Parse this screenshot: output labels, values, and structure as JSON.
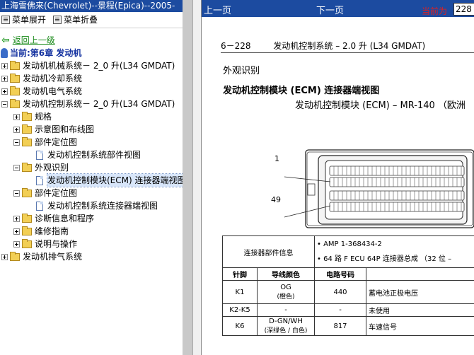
{
  "window": {
    "title": "上海雪佛来(Chevrolet)--景程(Epica)--2005-"
  },
  "toolbar": {
    "expand_label": "菜单展开",
    "collapse_label": "菜单折叠"
  },
  "tree": {
    "back_label": "返回上一级",
    "current_label": "当前:第6章  发动机",
    "items": [
      "发动机机械系统－  2_0 升(L34 GMDAT)",
      "发动机冷却系统",
      "发动机电气系统",
      "发动机控制系统－  2_0 升(L34 GMDAT)",
      "规格",
      "示意图和布线图",
      "部件定位图",
      "发动机控制系统部件视图",
      "外观识别",
      "发动机控制模块(ECM) 连接器端视图",
      "部件定位图",
      "发动机控制系统连接器端视图",
      "诊断信息和程序",
      "维修指南",
      "说明与操作",
      "发动机排气系统"
    ]
  },
  "viewer": {
    "prev_label": "上一页",
    "next_label": "下一页",
    "current_page_label": "当前为",
    "current_page_value": "228"
  },
  "document": {
    "page_number": "6－228",
    "header_title": "发动机控制系统 – 2.0 升 (L34 GMDAT)",
    "section_title": "外观识别",
    "subsection_title": "发动机控制模块 (ECM) 连接器端视图",
    "connector_title": "发动机控制模块 (ECM) – MR-140 （欧洲",
    "pin_label_1": "1",
    "pin_label_49": "49",
    "info_label": "连接器部件信息",
    "info_bullets": [
      "AMP 1-368434-2",
      "64 路 F ECU 64P 连接器总成 （32 位 –"
    ],
    "columns": [
      "针脚",
      "导线颜色",
      "电路号码",
      ""
    ],
    "rows": [
      {
        "pin": "K1",
        "color": "OG",
        "color_note": "(橙色)",
        "circuit": "440",
        "function": "蓄电池正极电压"
      },
      {
        "pin": "K2-K5",
        "color": "-",
        "color_note": "",
        "circuit": "-",
        "function": "未使用"
      },
      {
        "pin": "K6",
        "color": "D-GN/WH",
        "color_note": "(深绿色 / 白色)",
        "circuit": "817",
        "function": "车速信号"
      }
    ]
  }
}
